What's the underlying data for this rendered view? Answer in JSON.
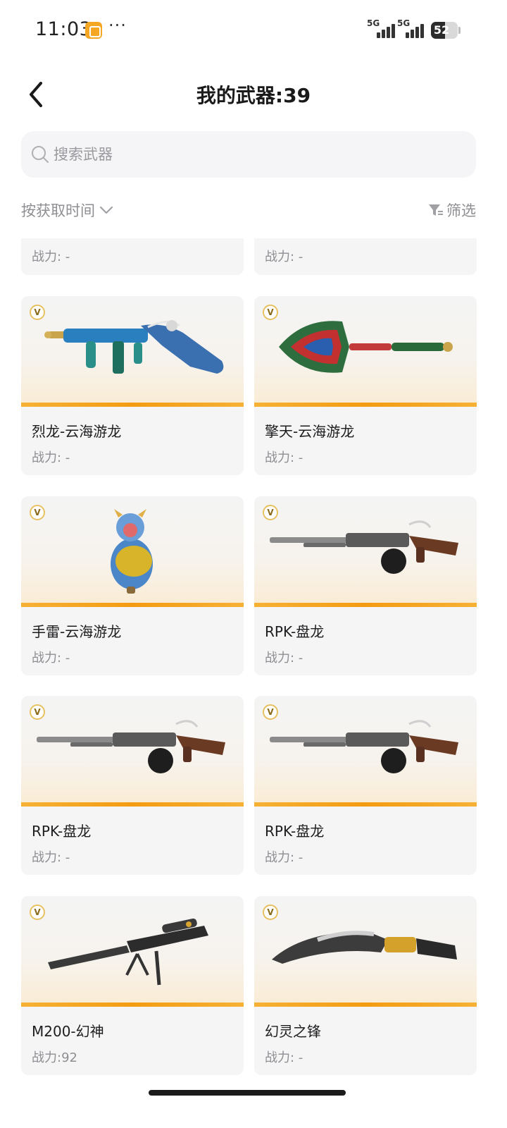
{
  "status_bar": {
    "time": "11:03",
    "more": "···",
    "network_1": "5G",
    "network_2": "5G",
    "battery": "52",
    "battery_level": 0.52
  },
  "header": {
    "title": "我的武器:39"
  },
  "search": {
    "placeholder": "搜索武器"
  },
  "toolbar": {
    "sort_label": "按获取时间",
    "filter_label": "筛选"
  },
  "partial_row": [
    {
      "power": "战力: -"
    },
    {
      "power": "战力: -"
    }
  ],
  "weapons": [
    {
      "name": "烈龙-云海游龙",
      "power": "战力: -",
      "badge": "V",
      "icon": "tommy-gun-dragon-icon"
    },
    {
      "name": "擎天-云海游龙",
      "power": "战力: -",
      "badge": "V",
      "icon": "dragon-shovel-icon"
    },
    {
      "name": "手雷-云海游龙",
      "power": "战力: -",
      "badge": "V",
      "icon": "dragon-grenade-icon"
    },
    {
      "name": "RPK-盘龙",
      "power": "战力: -",
      "badge": "V",
      "icon": "rpk-rifle-icon"
    },
    {
      "name": "RPK-盘龙",
      "power": "战力: -",
      "badge": "V",
      "icon": "rpk-rifle-icon"
    },
    {
      "name": "RPK-盘龙",
      "power": "战力: -",
      "badge": "V",
      "icon": "rpk-rifle-icon"
    },
    {
      "name": "M200-幻神",
      "power": "战力:92",
      "badge": "V",
      "icon": "sniper-rifle-icon"
    },
    {
      "name": "幻灵之锋",
      "power": "战力: -",
      "badge": "V",
      "icon": "kukri-knife-icon"
    }
  ],
  "colors": {
    "accent": "#f39c12",
    "text_secondary": "#8e8e93",
    "card_bg": "#f5f5f6"
  }
}
